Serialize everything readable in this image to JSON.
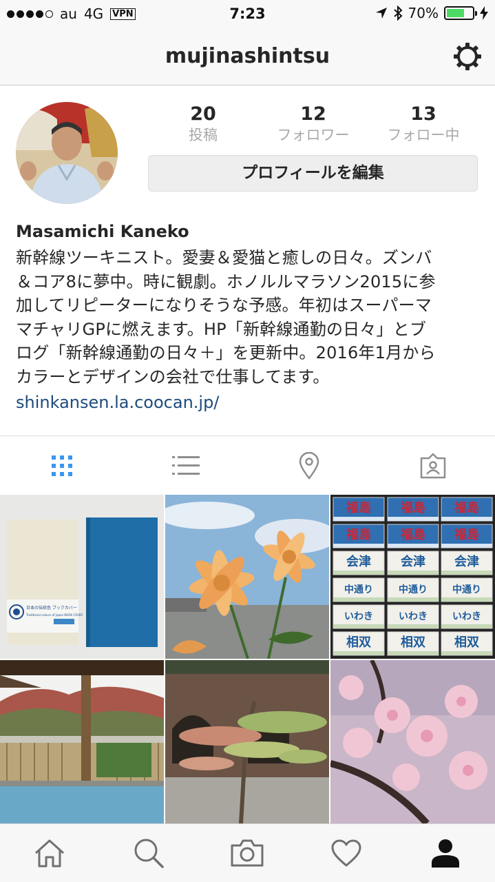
{
  "status_bar": {
    "carrier": "au",
    "network": "4G",
    "vpn": "VPN",
    "time": "7:23",
    "battery": "70%",
    "battery_level": 0.7
  },
  "nav": {
    "title": "mujinashintsu"
  },
  "profile": {
    "stats": [
      {
        "value": "20",
        "label": "投稿"
      },
      {
        "value": "12",
        "label": "フォロワー"
      },
      {
        "value": "13",
        "label": "フォロー中"
      }
    ],
    "edit_button": "プロフィールを編集",
    "name": "Masamichi Kaneko",
    "bio_lines": [
      "新幹線ツーキニスト。愛妻＆愛猫と癒しの日々。ズンバ",
      "＆コア8に夢中。時に観劇。ホノルルマラソン2015に参",
      "加してリピーターになりそうな予感。年初はスーパーマ",
      "マチャリGPに燃えます。HP「新幹線通勤の日々」とブ",
      "ログ「新幹線通勤の日々＋」を更新中。2016年1月から",
      "カラーとデザインの会社で仕事してます。"
    ],
    "website": "shinkansen.la.coocan.jp/"
  },
  "view_tabs": [
    {
      "icon": "grid-icon",
      "active": true
    },
    {
      "icon": "list-icon",
      "active": false
    },
    {
      "icon": "location-pin-icon",
      "active": false
    },
    {
      "icon": "tagged-person-icon",
      "active": false
    }
  ],
  "grid_photos": {
    "book_cover": {
      "card_line1": "日本の伝統色 ブックカバー",
      "card_line2": "Traditional colours of Japan BOOK COVER"
    },
    "station_signs": [
      "福島",
      "福島",
      "福島",
      "福島",
      "福島",
      "福島",
      "会津",
      "会津",
      "会津",
      "中通り",
      "中通り",
      "中通り",
      "いわき",
      "いわき",
      "いわき",
      "相双",
      "相双",
      "相双"
    ]
  },
  "tab_bar": [
    {
      "icon": "home-icon"
    },
    {
      "icon": "search-icon"
    },
    {
      "icon": "camera-icon"
    },
    {
      "icon": "heart-icon"
    },
    {
      "icon": "profile-icon",
      "active": true
    }
  ],
  "colors": {
    "accent_blue": "#3897f0",
    "link": "#1d4b7c",
    "battery_green": "#4cd964",
    "muted_label": "#a8a8a8"
  }
}
